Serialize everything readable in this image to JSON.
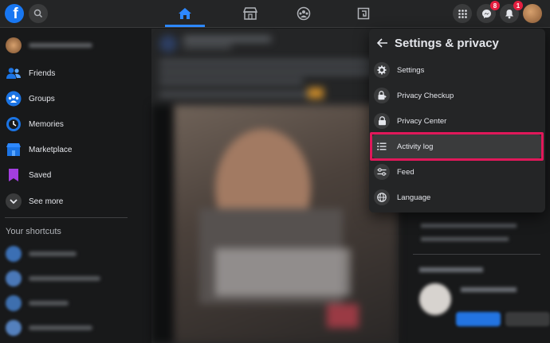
{
  "topbar": {
    "logo_letter": "f",
    "messenger_badge": "8",
    "notifications_badge": "1",
    "icons": [
      "facebook-logo",
      "search-icon",
      "home-icon",
      "marketplace-store-icon",
      "groups-icon",
      "gaming-icon",
      "menu-grid-icon",
      "messenger-icon",
      "bell-icon"
    ]
  },
  "sidebar": {
    "items": [
      {
        "label": "Friends",
        "icon": "friends-icon"
      },
      {
        "label": "Groups",
        "icon": "groups-icon"
      },
      {
        "label": "Memories",
        "icon": "memories-icon"
      },
      {
        "label": "Marketplace",
        "icon": "marketplace-icon"
      },
      {
        "label": "Saved",
        "icon": "saved-icon"
      },
      {
        "label": "See more",
        "icon": "chevron-down-icon"
      }
    ],
    "shortcuts_title": "Your shortcuts"
  },
  "settings_panel": {
    "title": "Settings & privacy",
    "items": [
      {
        "label": "Settings",
        "icon": "gear-icon"
      },
      {
        "label": "Privacy Checkup",
        "icon": "lock-plus-icon"
      },
      {
        "label": "Privacy Center",
        "icon": "lock-icon"
      },
      {
        "label": "Activity log",
        "icon": "list-icon"
      },
      {
        "label": "Feed",
        "icon": "sliders-icon"
      },
      {
        "label": "Language",
        "icon": "globe-icon"
      }
    ]
  },
  "colors": {
    "accent": "#2d88ff",
    "highlight_border": "#e0185a",
    "badge": "#e41e3f",
    "background": "#18191a",
    "surface": "#242526"
  }
}
